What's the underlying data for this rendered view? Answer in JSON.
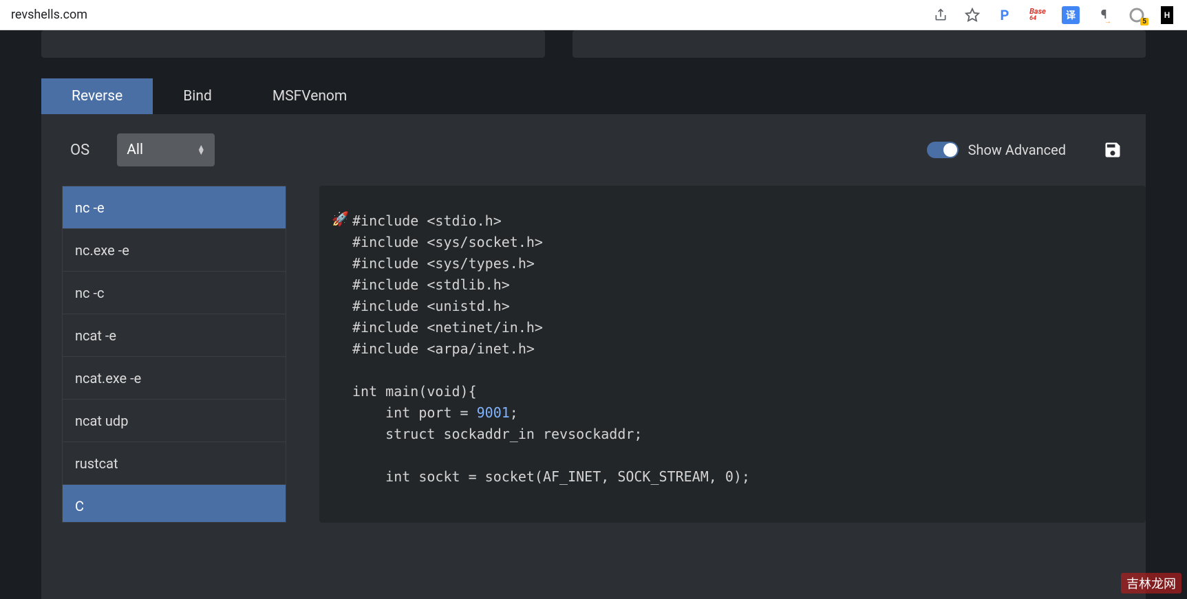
{
  "browser": {
    "url": "revshells.com",
    "badge_count": "5"
  },
  "tabs": [
    {
      "label": "Reverse",
      "active": true
    },
    {
      "label": "Bind",
      "active": false
    },
    {
      "label": "MSFVenom",
      "active": false
    }
  ],
  "controls": {
    "os_label": "OS",
    "os_value": "All",
    "show_advanced_label": "Show Advanced",
    "show_advanced_on": true
  },
  "sidebar": {
    "items": [
      {
        "label": "nc -e",
        "active": true
      },
      {
        "label": "nc.exe -e",
        "active": false
      },
      {
        "label": "nc -c",
        "active": false
      },
      {
        "label": "ncat -e",
        "active": false
      },
      {
        "label": "ncat.exe -e",
        "active": false
      },
      {
        "label": "ncat udp",
        "active": false
      },
      {
        "label": "rustcat",
        "active": false
      },
      {
        "label": "C",
        "active": true
      }
    ]
  },
  "code": {
    "lines": [
      "#include <stdio.h>",
      "#include <sys/socket.h>",
      "#include <sys/types.h>",
      "#include <stdlib.h>",
      "#include <unistd.h>",
      "#include <netinet/in.h>",
      "#include <arpa/inet.h>",
      "",
      "int main(void){",
      "    int port = 9001;",
      "    struct sockaddr_in revsockaddr;",
      "",
      "    int sockt = socket(AF_INET, SOCK_STREAM, 0);"
    ],
    "port_value": "9001"
  },
  "watermark": "吉林龙网"
}
